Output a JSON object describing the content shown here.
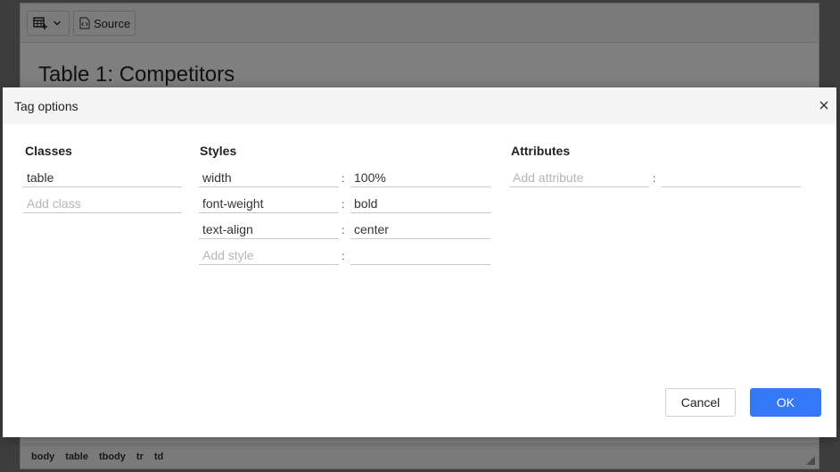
{
  "toolbar": {
    "table_icon": "table-insert-icon",
    "dropdown_icon": "chevron-down-icon",
    "source_icon": "source-code-icon",
    "source_label": "Source"
  },
  "content": {
    "heading": "Table 1: Competitors"
  },
  "statusbar": {
    "path": [
      "body",
      "table",
      "tbody",
      "tr",
      "td"
    ]
  },
  "dialog": {
    "title": "Tag options",
    "close_icon": "close-icon",
    "classes": {
      "title": "Classes",
      "items": [
        "table"
      ],
      "add_placeholder": "Add class"
    },
    "styles": {
      "title": "Styles",
      "items": [
        {
          "name": "width",
          "value": "100%"
        },
        {
          "name": "font-weight",
          "value": "bold"
        },
        {
          "name": "text-align",
          "value": "center"
        }
      ],
      "add_placeholder": "Add style",
      "separator": ":"
    },
    "attributes": {
      "title": "Attributes",
      "add_placeholder": "Add attribute",
      "separator": ":"
    },
    "cancel_label": "Cancel",
    "ok_label": "OK"
  },
  "colors": {
    "primary": "#3478f6"
  }
}
